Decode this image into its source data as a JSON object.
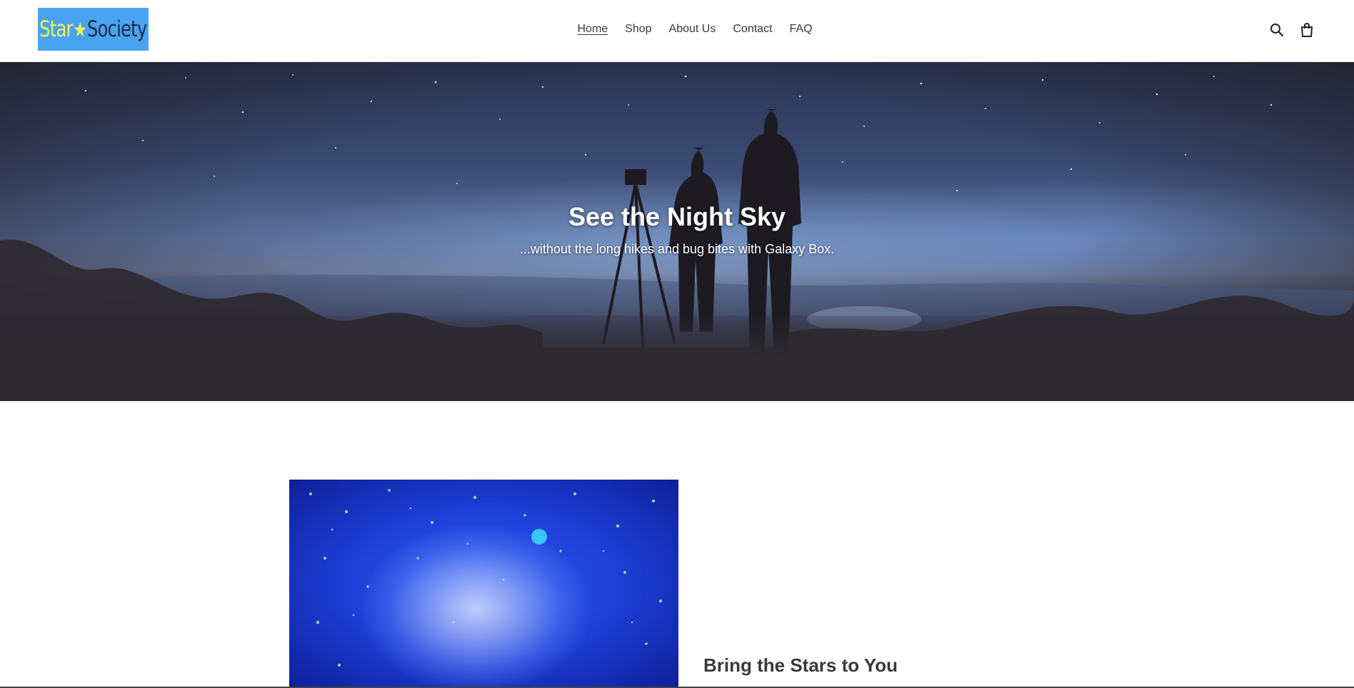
{
  "brand": {
    "logo_text_star": "Star",
    "logo_text_society": "Society",
    "logo_bg": "#4aa3f0"
  },
  "nav": {
    "items": [
      {
        "label": "Home",
        "active": true
      },
      {
        "label": "Shop",
        "active": false
      },
      {
        "label": "About Us",
        "active": false
      },
      {
        "label": "Contact",
        "active": false
      },
      {
        "label": "FAQ",
        "active": false
      }
    ]
  },
  "header_icons": [
    "search-icon",
    "cart-icon"
  ],
  "hero": {
    "title": "See the Night Sky",
    "subtitle": "...without the long hikes and bug bites with Galaxy Box."
  },
  "feature": {
    "heading": "Bring the Stars to You"
  },
  "colors": {
    "text": "#3a3a3a",
    "hero_text": "#ffffff"
  }
}
